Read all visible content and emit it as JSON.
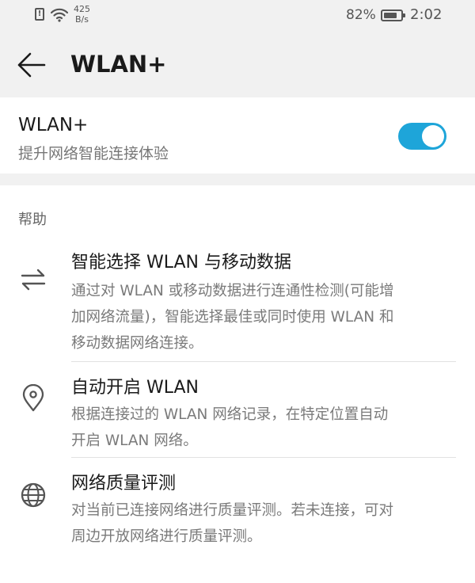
{
  "status_bar": {
    "net_speed_value": "425",
    "net_speed_unit": "B/s",
    "alert_glyph": "!",
    "battery_percent": "82%",
    "battery_level": 0.82,
    "time": "2:02"
  },
  "header": {
    "title": "WLAN+"
  },
  "wlan_toggle": {
    "title": "WLAN+",
    "subtitle": "提升网络智能连接体验",
    "enabled": true,
    "accent_color": "#1ea5d9"
  },
  "help": {
    "section_title": "帮助",
    "items": [
      {
        "icon": "swap-arrows-icon",
        "title": "智能选择 WLAN 与移动数据",
        "desc_lines": [
          "通过对 WLAN 或移动数据进行连通性检测(可能增",
          "加网络流量)，智能选择最佳或同时使用 WLAN 和",
          "移动数据网络连接。"
        ]
      },
      {
        "icon": "location-pin-icon",
        "title": "自动开启 WLAN",
        "desc_lines": [
          "根据连接过的 WLAN 网络记录，在特定位置自动",
          "开启 WLAN 网络。"
        ]
      },
      {
        "icon": "globe-icon",
        "title": "网络质量评测",
        "desc_lines": [
          "对当前已连接网络进行质量评测。若未连接，可对",
          "周边开放网络进行质量评测。"
        ]
      }
    ]
  }
}
